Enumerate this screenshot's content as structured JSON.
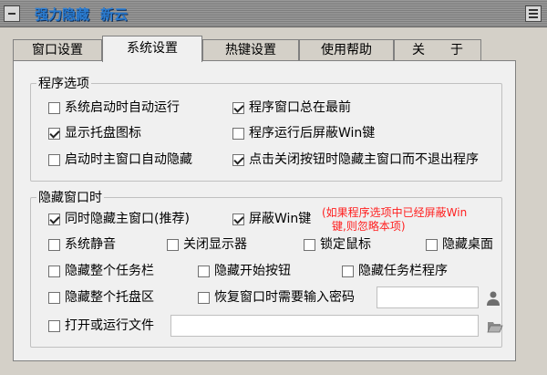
{
  "window": {
    "title": "强力隐藏",
    "title_sub": "新云"
  },
  "tabs": [
    {
      "label": "窗口设置"
    },
    {
      "label": "系统设置"
    },
    {
      "label": "热键设置"
    },
    {
      "label": "使用帮助"
    },
    {
      "label": "关　　于"
    }
  ],
  "program_options": {
    "title": "程序选项",
    "items": [
      {
        "label": "系统启动时自动运行",
        "checked": false
      },
      {
        "label": "程序窗口总在最前",
        "checked": true
      },
      {
        "label": "显示托盘图标",
        "checked": true
      },
      {
        "label": "程序运行后屏蔽Win键",
        "checked": false
      },
      {
        "label": "启动时主窗口自动隐藏",
        "checked": false
      },
      {
        "label": "点击关闭按钮时隐藏主窗口而不退出程序",
        "checked": true
      }
    ]
  },
  "hide_options": {
    "title": "隐藏窗口时",
    "items": [
      {
        "label": "同时隐藏主窗口(推荐)",
        "checked": true
      },
      {
        "label": "屏蔽Win键",
        "checked": true
      },
      {
        "label": "系统静音",
        "checked": false
      },
      {
        "label": "关闭显示器",
        "checked": false
      },
      {
        "label": "锁定鼠标",
        "checked": false
      },
      {
        "label": "隐藏桌面",
        "checked": false
      },
      {
        "label": "隐藏整个任务栏",
        "checked": false
      },
      {
        "label": "隐藏开始按钮",
        "checked": false
      },
      {
        "label": "隐藏任务栏程序",
        "checked": false
      },
      {
        "label": "隐藏整个托盘区",
        "checked": false
      },
      {
        "label": "恢复窗口时需要输入密码",
        "checked": false
      },
      {
        "label": "打开或运行文件",
        "checked": false
      }
    ],
    "note_line1": "(如果程序选项中已经屏蔽Win",
    "note_line2": "键,则忽略本项)",
    "password_value": "",
    "file_path_value": ""
  },
  "icons": {
    "password": "user-lock-icon",
    "file": "folder-open-icon"
  },
  "colors": {
    "title_text": "#2b7cd1",
    "note_text": "#ff2020"
  }
}
